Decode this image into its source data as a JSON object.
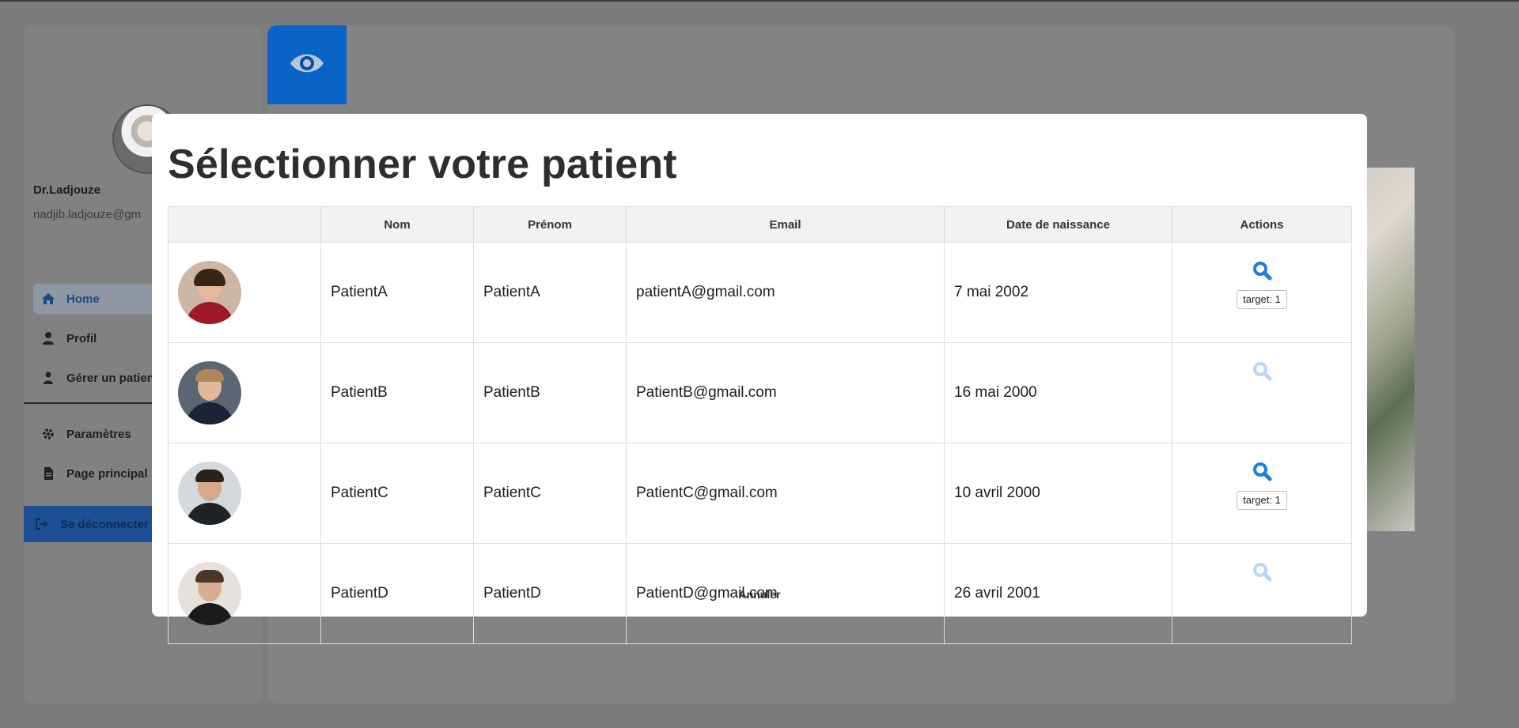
{
  "sidebar": {
    "doctor_name": "Dr.Ladjouze",
    "doctor_email": "nadjib.ladjouze@gm",
    "nav": [
      {
        "label": "Home",
        "icon": "home-icon",
        "active": true
      },
      {
        "label": "Profil",
        "icon": "user-icon"
      },
      {
        "label": "Gérer un patien",
        "icon": "users-icon"
      },
      {
        "label": "Paramètres",
        "icon": "gear-icon"
      },
      {
        "label": "Page principal",
        "icon": "file-icon"
      }
    ],
    "logout_label": "Se déconnecter"
  },
  "modal": {
    "title": "Sélectionner votre patient",
    "columns": [
      "",
      "Nom",
      "Prénom",
      "Email",
      "Date de naissance",
      "Actions"
    ],
    "rows": [
      {
        "nom": "PatientA",
        "prenom": "PatientA",
        "email": "patientA@gmail.com",
        "naissance": "7 mai 2002",
        "action_enabled": true,
        "tag": "target: 1"
      },
      {
        "nom": "PatientB",
        "prenom": "PatientB",
        "email": "PatientB@gmail.com",
        "naissance": "16 mai 2000",
        "action_enabled": false,
        "tag": ""
      },
      {
        "nom": "PatientC",
        "prenom": "PatientC",
        "email": "PatientC@gmail.com",
        "naissance": "10 avril 2000",
        "action_enabled": true,
        "tag": "target: 1"
      },
      {
        "nom": "PatientD",
        "prenom": "PatientD",
        "email": "PatientD@gmail.com",
        "naissance": "26 avril 2001",
        "action_enabled": false,
        "tag": ""
      }
    ],
    "cancel_label": "Annuler"
  },
  "colors": {
    "accent": "#0a64c8",
    "search_enabled": "#1a7fe0",
    "search_disabled": "#b9d6f5",
    "overlay": "#7c7c7c"
  }
}
